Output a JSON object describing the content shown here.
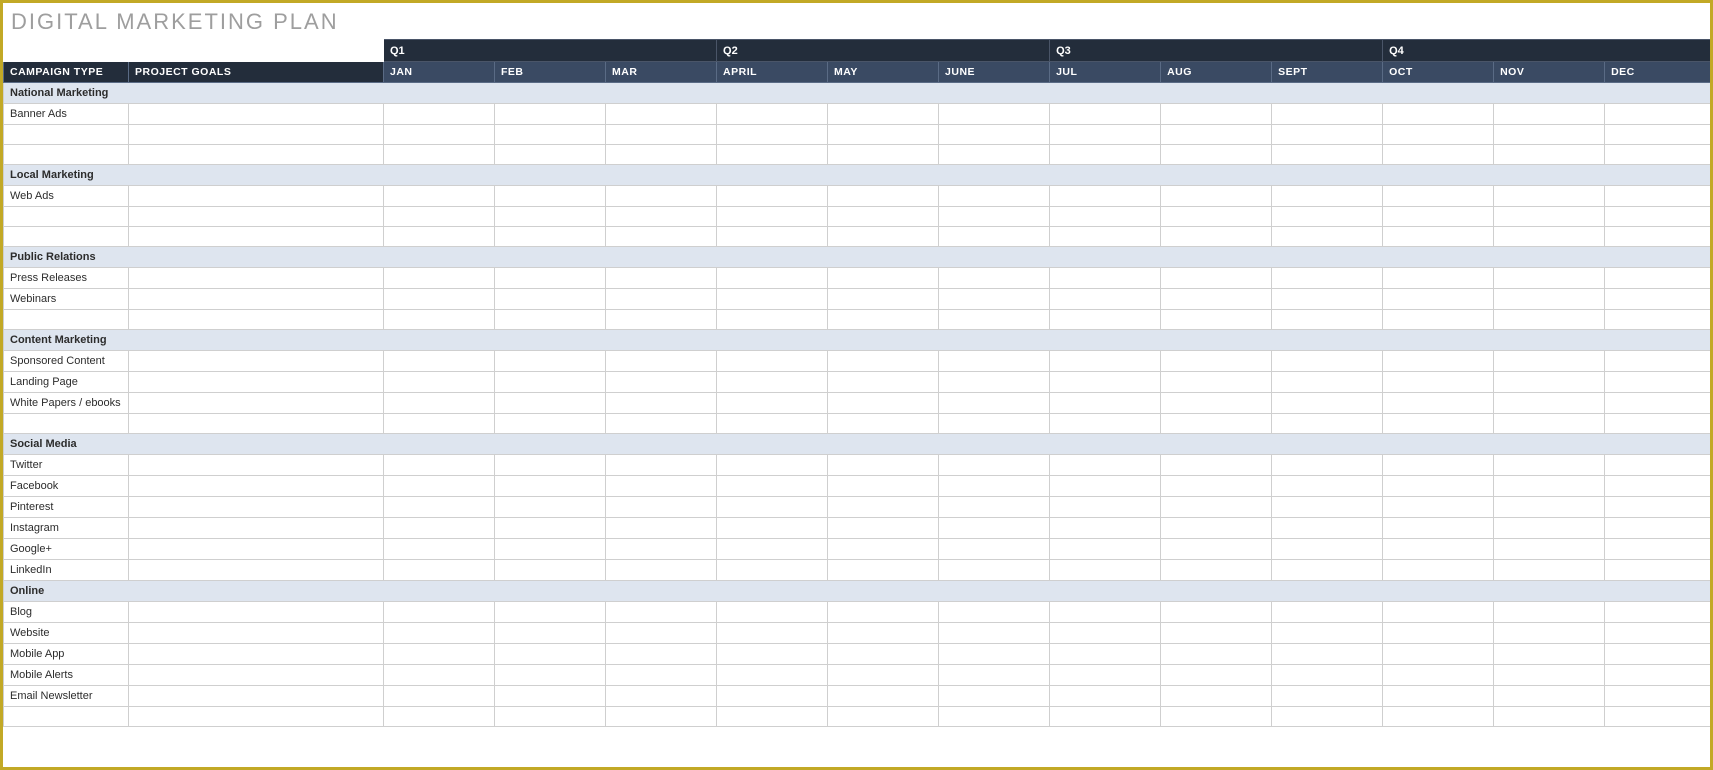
{
  "title": "DIGITAL MARKETING PLAN",
  "headers": {
    "campaign_type": "CAMPAIGN TYPE",
    "project_goals": "PROJECT GOALS",
    "quarters": [
      "Q1",
      "Q2",
      "Q3",
      "Q4"
    ],
    "months": [
      "JAN",
      "FEB",
      "MAR",
      "APRIL",
      "MAY",
      "JUNE",
      "JUL",
      "AUG",
      "SEPT",
      "OCT",
      "NOV",
      "DEC"
    ]
  },
  "sections": [
    {
      "name": "National Marketing",
      "rows": [
        "Banner Ads",
        "",
        ""
      ]
    },
    {
      "name": "Local Marketing",
      "rows": [
        "Web Ads",
        "",
        ""
      ]
    },
    {
      "name": "Public Relations",
      "rows": [
        "Press Releases",
        "Webinars",
        ""
      ]
    },
    {
      "name": "Content Marketing",
      "rows": [
        "Sponsored Content",
        "Landing Page",
        "White Papers / ebooks",
        ""
      ]
    },
    {
      "name": "Social Media",
      "rows": [
        "Twitter",
        "Facebook",
        "Pinterest",
        "Instagram",
        "Google+",
        "LinkedIn"
      ]
    },
    {
      "name": "Online",
      "rows": [
        "Blog",
        "Website",
        "Mobile App",
        "Mobile Alerts",
        "Email Newsletter",
        ""
      ]
    }
  ]
}
